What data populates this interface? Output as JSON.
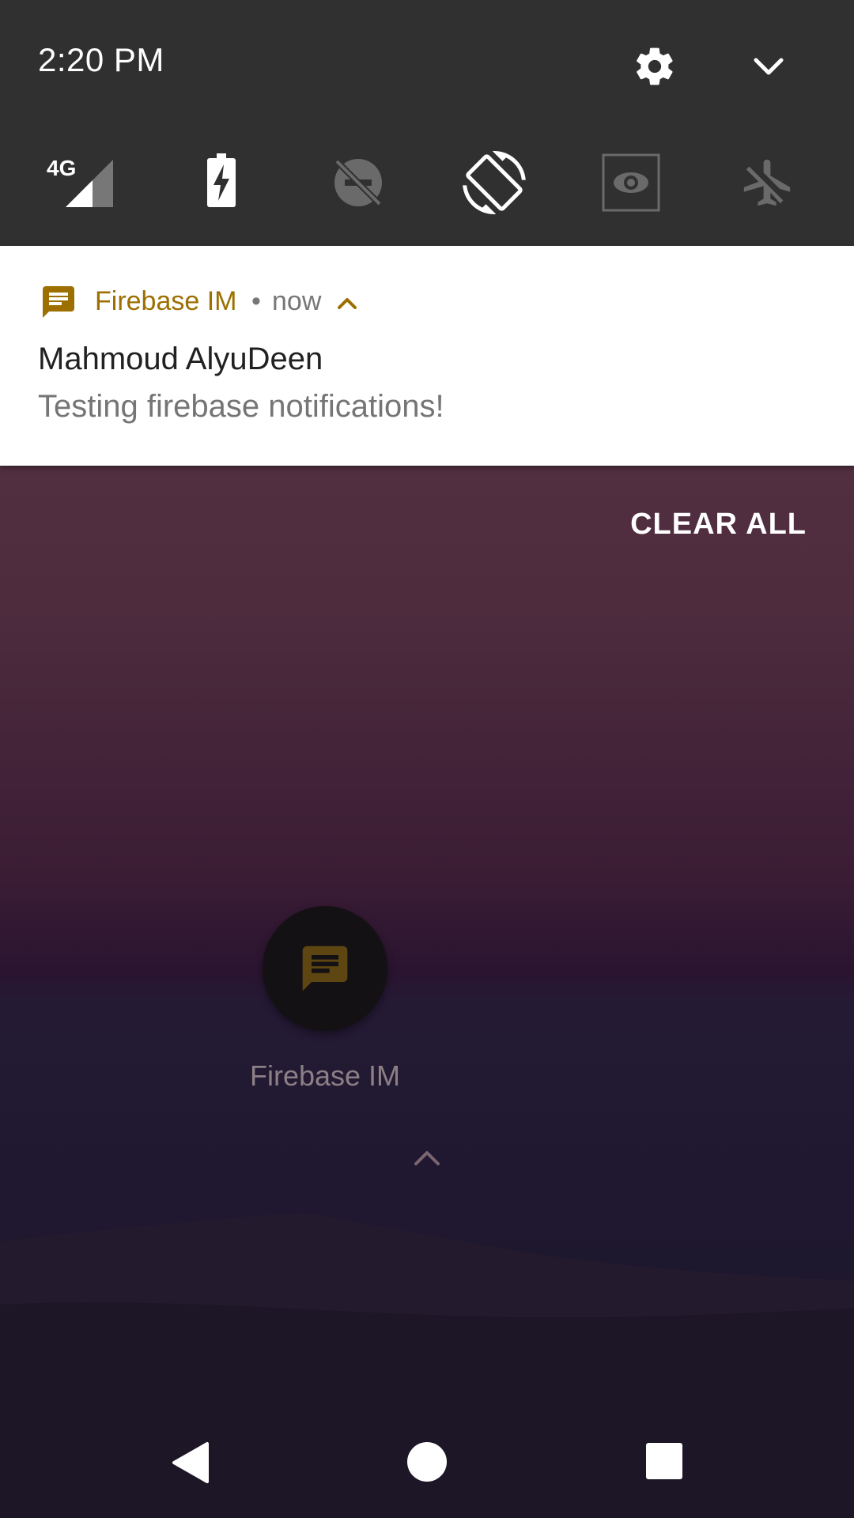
{
  "status": {
    "time": "2:20 PM"
  },
  "quick_settings": {
    "tiles": [
      {
        "icon": "cellular-4g-icon",
        "label": "4G"
      },
      {
        "icon": "battery-saver-icon"
      },
      {
        "icon": "do-not-disturb-off-icon"
      },
      {
        "icon": "auto-rotate-icon"
      },
      {
        "icon": "cast-screen-icon"
      },
      {
        "icon": "airplane-mode-off-icon"
      }
    ]
  },
  "notification": {
    "app_name": "Firebase IM",
    "separator": "•",
    "time": "now",
    "title": "Mahmoud AlyuDeen",
    "text": "Testing firebase notifications!",
    "accent_color": "#9c6f00"
  },
  "clear_all_label": "CLEAR ALL",
  "home_app": {
    "label": "Firebase IM",
    "icon": "chat-icon"
  },
  "colors": {
    "qs_background": "#303030",
    "notification_background": "#ffffff",
    "accent": "#9c6f00"
  }
}
